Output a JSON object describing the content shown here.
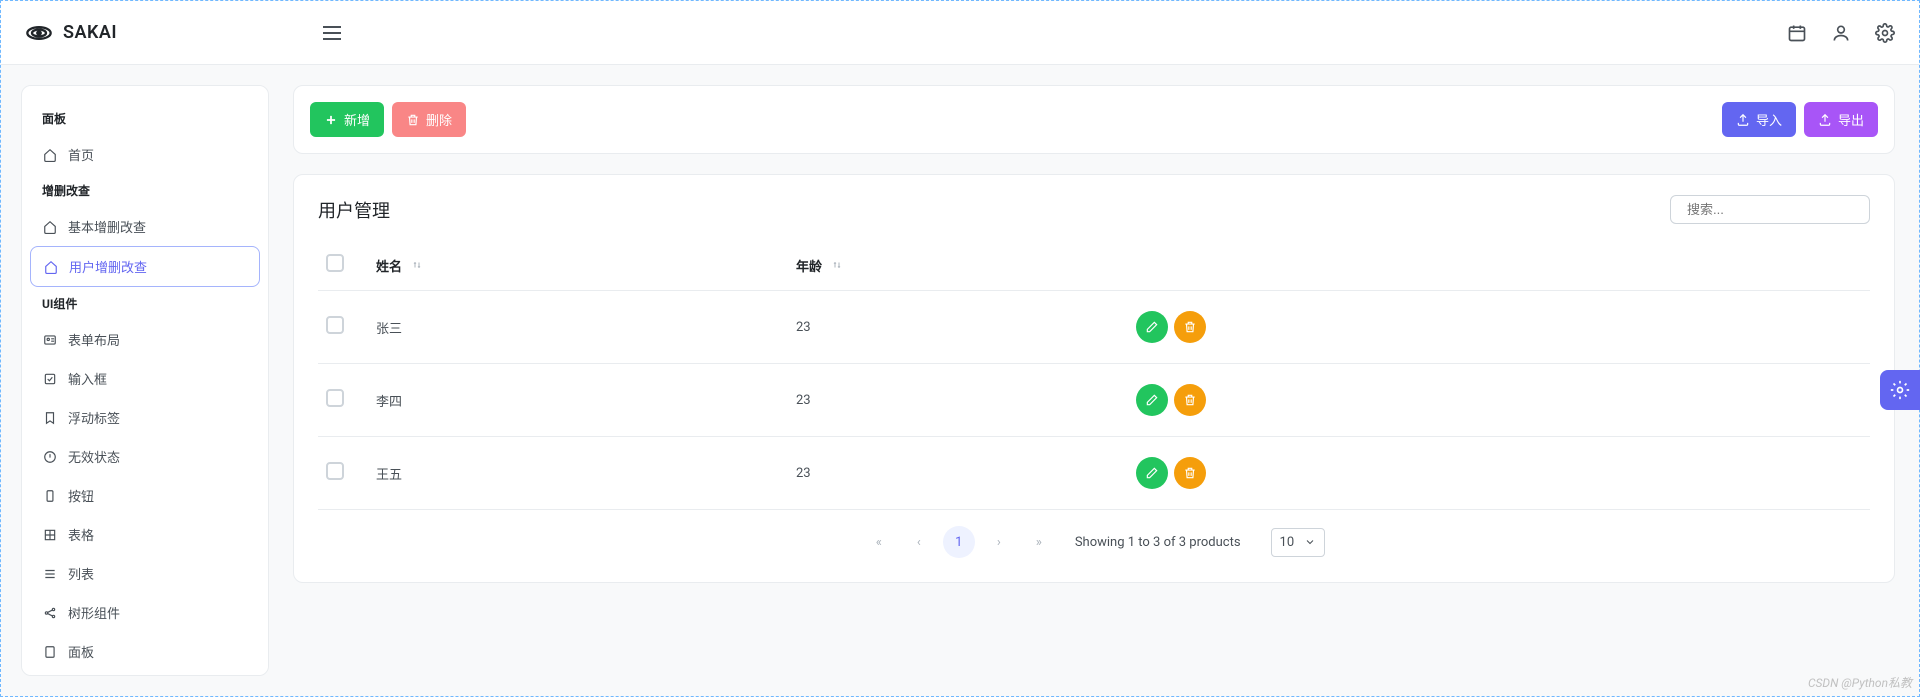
{
  "brand": "SAKAI",
  "topbar_icons": {
    "calendar": "calendar",
    "user": "user",
    "settings": "settings"
  },
  "sidebar": {
    "sections": [
      {
        "title": "面板",
        "items": [
          {
            "label": "首页",
            "icon": "home"
          }
        ]
      },
      {
        "title": "增删改查",
        "items": [
          {
            "label": "基本增删改查",
            "icon": "home"
          },
          {
            "label": "用户增删改查",
            "icon": "home",
            "active": true
          }
        ]
      },
      {
        "title": "UI组件",
        "items": [
          {
            "label": "表单布局",
            "icon": "id-card"
          },
          {
            "label": "输入框",
            "icon": "check-square"
          },
          {
            "label": "浮动标签",
            "icon": "bookmark"
          },
          {
            "label": "无效状态",
            "icon": "warning"
          },
          {
            "label": "按钮",
            "icon": "mobile"
          },
          {
            "label": "表格",
            "icon": "table"
          },
          {
            "label": "列表",
            "icon": "list"
          },
          {
            "label": "树形组件",
            "icon": "share"
          },
          {
            "label": "面板",
            "icon": "tablet"
          }
        ]
      }
    ]
  },
  "toolbar": {
    "add": "新增",
    "delete": "删除",
    "import": "导入",
    "export": "导出"
  },
  "card": {
    "title": "用户管理",
    "search_placeholder": "搜索..."
  },
  "table": {
    "headers": {
      "name": "姓名",
      "age": "年龄"
    },
    "rows": [
      {
        "name": "张三",
        "age": "23"
      },
      {
        "name": "李四",
        "age": "23"
      },
      {
        "name": "王五",
        "age": "23"
      }
    ]
  },
  "paginator": {
    "current": "1",
    "info": "Showing 1 to 3 of 3 products",
    "per_page": "10"
  },
  "watermark": "CSDN @Python私教"
}
